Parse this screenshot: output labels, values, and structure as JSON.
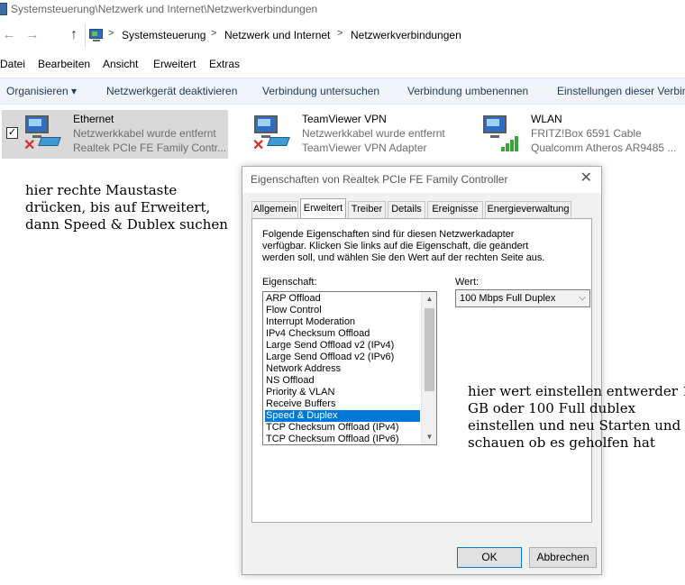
{
  "window": {
    "title": "Systemsteuerung\\Netzwerk und Internet\\Netzwerkverbindungen"
  },
  "address": {
    "crumbs": [
      "Systemsteuerung",
      "Netzwerk und Internet",
      "Netzwerkverbindungen"
    ],
    "separator": ">"
  },
  "nav": {
    "back": "←",
    "forward": "→",
    "up": "↑"
  },
  "menubar": [
    "Datei",
    "Bearbeiten",
    "Ansicht",
    "Erweitert",
    "Extras"
  ],
  "commandbar": [
    "Organisieren ▾",
    "Netzwerkgerät deaktivieren",
    "Verbindung untersuchen",
    "Verbindung umbenennen",
    "Einstellungen dieser Verbin"
  ],
  "connections": [
    {
      "name": "Ethernet",
      "status": "Netzwerkkabel wurde entfernt",
      "adapter": "Realtek PCIe FE Family Contr...",
      "selected": true,
      "checked": "✓",
      "icon": "ethernet-disconnected-icon"
    },
    {
      "name": "TeamViewer VPN",
      "status": "Netzwerkkabel wurde entfernt",
      "adapter": "TeamViewer VPN Adapter",
      "selected": false,
      "icon": "vpn-disconnected-icon"
    },
    {
      "name": "WLAN",
      "status": "FRITZ!Box 6591 Cable",
      "adapter": "Qualcomm Atheros AR9485 ...",
      "selected": false,
      "icon": "wifi-signal-icon"
    }
  ],
  "annotation_left": "hier rechte Maustaste drücken, bis auf Erweitert, dann Speed & Dublex suchen",
  "dialog": {
    "title": "Eigenschaften von Realtek PCIe FE Family Controller",
    "close": "✕",
    "tabs": [
      "Allgemein",
      "Erweitert",
      "Treiber",
      "Details",
      "Ereignisse",
      "Energieverwaltung"
    ],
    "active_tab": "Erweitert",
    "description": "Folgende Eigenschaften sind für diesen Netzwerkadapter verfügbar. Klicken Sie links auf die Eigenschaft, die geändert werden soll, und wählen Sie den Wert auf der rechten Seite aus.",
    "property_label": "Eigenschaft:",
    "value_label": "Wert:",
    "properties": [
      "ARP Offload",
      "Flow Control",
      "Interrupt Moderation",
      "IPv4 Checksum Offload",
      "Large Send Offload v2 (IPv4)",
      "Large Send Offload v2 (IPv6)",
      "Network Address",
      "NS Offload",
      "Priority & VLAN",
      "Receive Buffers",
      "Speed & Duplex",
      "TCP Checksum Offload (IPv4)",
      "TCP Checksum Offload (IPv6)"
    ],
    "selected_property": "Speed & Duplex",
    "value": "100 Mbps Full Duplex",
    "scroll_up": "▲",
    "scroll_down": "▼",
    "dropdown_arrow": "⌵",
    "ok": "OK",
    "cancel": "Abbrechen"
  },
  "annotation_right": "hier wert einstellen entwerder 1 GB oder 100 Full dublex einstellen und neu Starten und schauen ob es geholfen hat"
}
